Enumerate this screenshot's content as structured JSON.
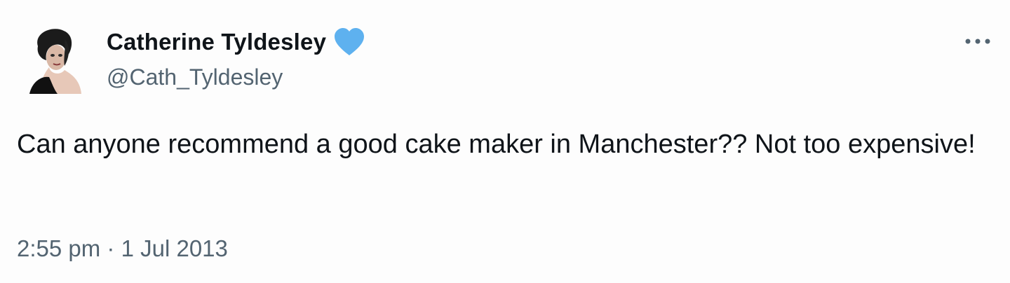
{
  "tweet": {
    "display_name": "Catherine Tyldesley",
    "handle": "@Cath_Tyldesley",
    "verified_icon": "verified-heart-icon",
    "text": "Can anyone recommend a good cake maker in Manchester?? Not too expensive!",
    "time": "2:55 pm",
    "separator": "·",
    "date": "1 Jul 2013",
    "more_icon": "more-options-icon",
    "colors": {
      "name": "#0f1419",
      "secondary": "#536471",
      "verified": "#5eb1ef",
      "background": "#fdfdfd"
    }
  }
}
